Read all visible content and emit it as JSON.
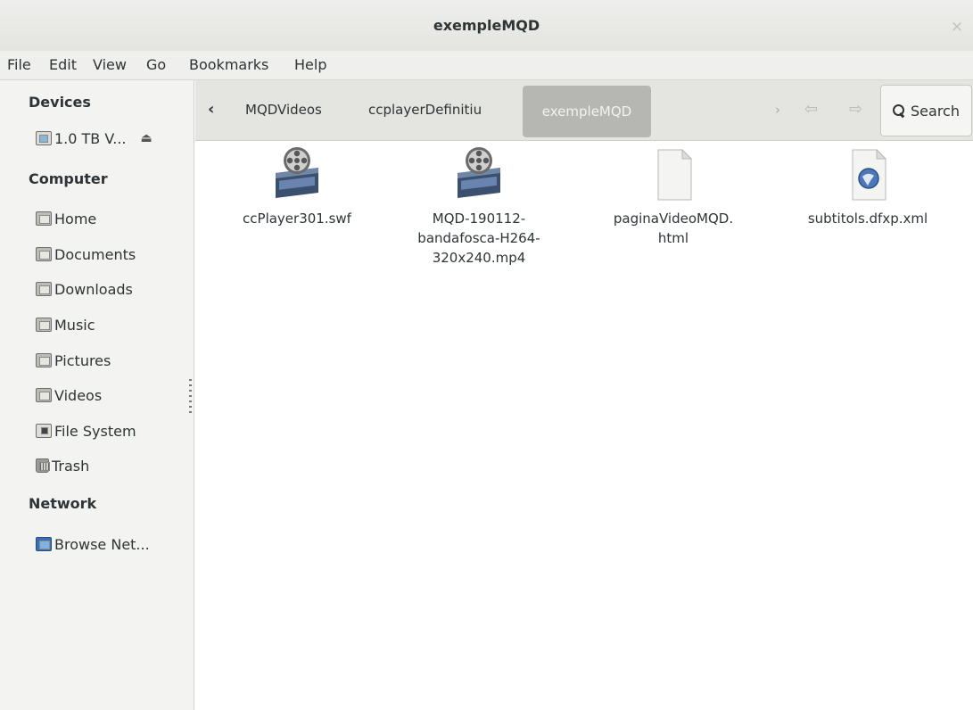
{
  "window": {
    "title": "exempleMQD",
    "close_glyph": "×"
  },
  "menubar": {
    "items": [
      "File",
      "Edit",
      "View",
      "Go",
      "Bookmarks",
      "Help"
    ]
  },
  "sidebar": {
    "sections": {
      "devices": "Devices",
      "computer": "Computer",
      "network": "Network"
    },
    "devices": [
      {
        "label": "1.0 TB V...",
        "icon": "drive-icon",
        "eject": "⏏"
      }
    ],
    "places": [
      {
        "label": "Home",
        "icon": "home-folder-icon"
      },
      {
        "label": "Documents",
        "icon": "documents-folder-icon"
      },
      {
        "label": "Downloads",
        "icon": "downloads-folder-icon"
      },
      {
        "label": "Music",
        "icon": "music-folder-icon"
      },
      {
        "label": "Pictures",
        "icon": "pictures-folder-icon"
      },
      {
        "label": "Videos",
        "icon": "videos-folder-icon"
      },
      {
        "label": "File System",
        "icon": "file-system-icon"
      },
      {
        "label": "Trash",
        "icon": "trash-icon"
      }
    ],
    "network": [
      {
        "label": "Browse Net...",
        "icon": "network-icon"
      }
    ]
  },
  "pathbar": {
    "back_glyph": "‹",
    "crumbs": [
      "MQDVideos",
      "ccplayerDefinitiu",
      "exempleMQD"
    ],
    "next_glyph": "›",
    "history_back_glyph": "⇦",
    "history_forward_glyph": "⇨",
    "search_label": "Search"
  },
  "files": [
    {
      "name": "ccPlayer301.swf",
      "icon": "video-file-icon"
    },
    {
      "name_lines": [
        "MQD-190112-",
        "bandafosca-H264-",
        "320x240.mp4"
      ],
      "icon": "video-file-icon"
    },
    {
      "name_lines": [
        "paginaVideoMQD.",
        "html"
      ],
      "icon": "blank-document-icon"
    },
    {
      "name": "subtitols.dfxp.xml",
      "icon": "xml-document-icon"
    }
  ],
  "colors": {
    "titlebar": "#e9e9e6",
    "sidebar": "#f3f3f2",
    "pathbar": "#e4e4e1",
    "active_crumb": "#b6b6b2",
    "text": "#2e3436"
  }
}
